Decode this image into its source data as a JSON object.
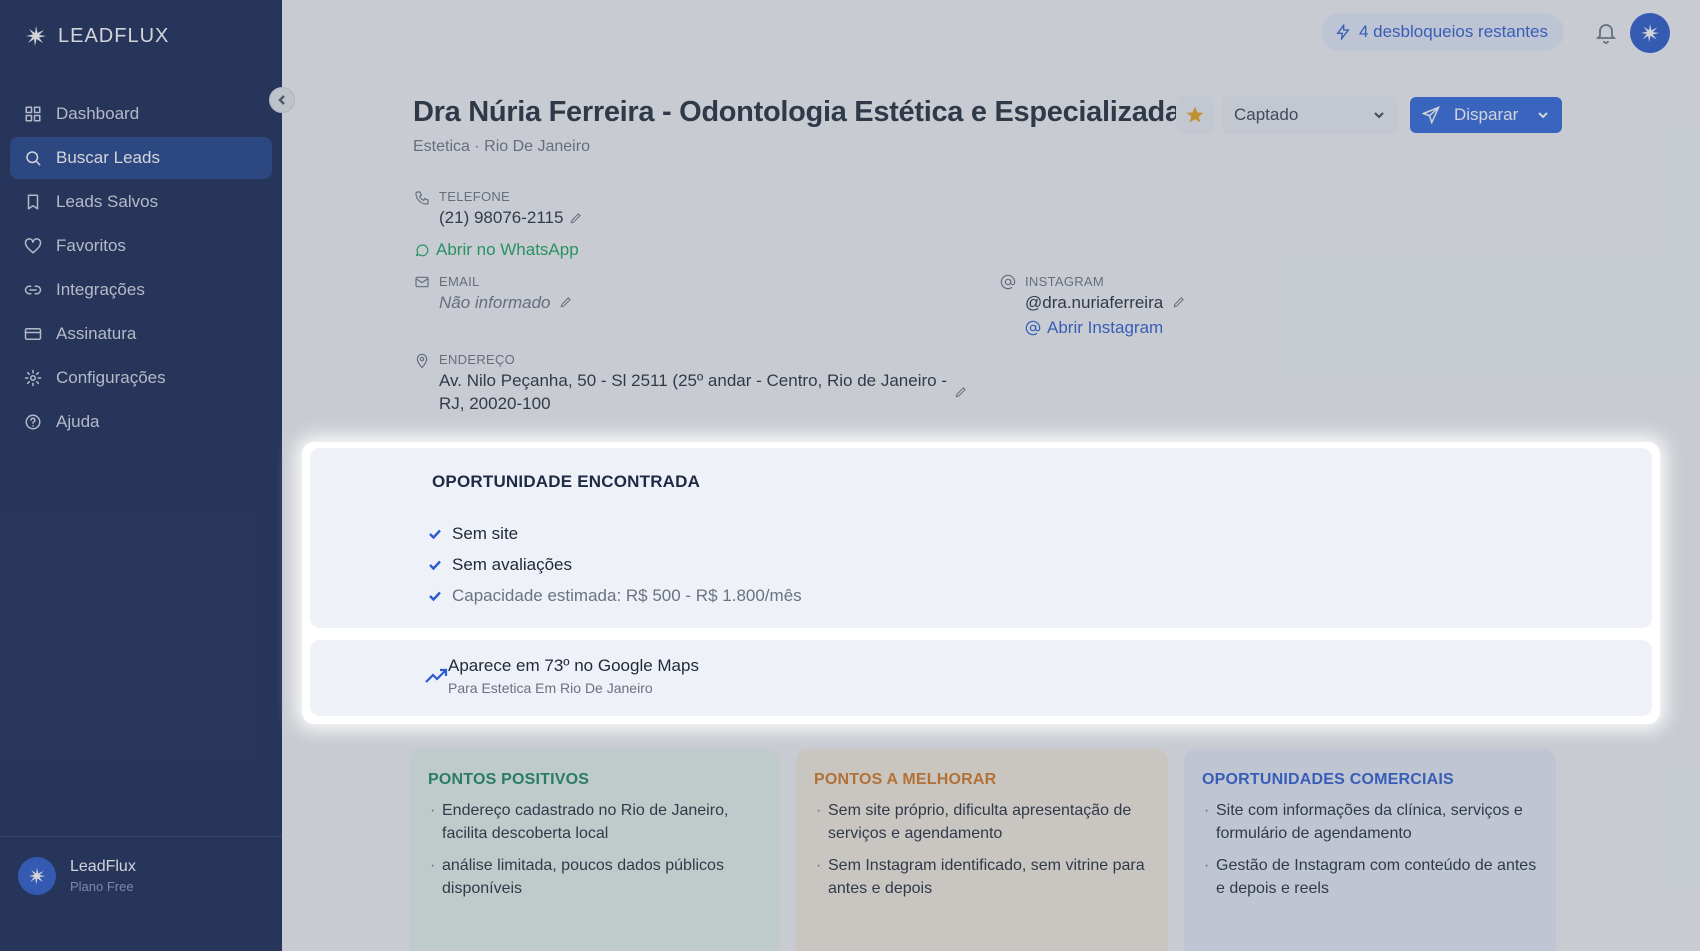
{
  "brand": {
    "name": "LEADFLUX"
  },
  "sidebar": {
    "items": [
      {
        "label": "Dashboard",
        "icon": "grid-icon"
      },
      {
        "label": "Buscar Leads",
        "icon": "search-icon",
        "active": true
      },
      {
        "label": "Leads Salvos",
        "icon": "bookmark-icon"
      },
      {
        "label": "Favoritos",
        "icon": "heart-icon"
      },
      {
        "label": "Integrações",
        "icon": "link-icon"
      },
      {
        "label": "Assinatura",
        "icon": "credit-card-icon"
      },
      {
        "label": "Configurações",
        "icon": "gear-icon"
      },
      {
        "label": "Ajuda",
        "icon": "help-icon"
      }
    ],
    "footer": {
      "name": "LeadFlux",
      "plan": "Plano Free"
    }
  },
  "topbar": {
    "unlocks": "4 desbloqueios restantes"
  },
  "lead": {
    "title": "Dra Núria Ferreira - Odontologia Estética e Especializada",
    "subtitle": "Estetica · Rio De Janeiro",
    "status": "Captado",
    "send_label": "Disparar",
    "phone_label": "TELEFONE",
    "phone": "(21) 98076-2115",
    "whatsapp_link": "Abrir no WhatsApp",
    "email_label": "EMAIL",
    "email": "Não informado",
    "instagram_label": "INSTAGRAM",
    "instagram": "@dra.nuriaferreira",
    "instagram_link": "Abrir Instagram",
    "address_label": "ENDEREÇO",
    "address_line1": "Av. Nilo Peçanha, 50 - Sl 2511 (25º andar - Centro, Rio de Janeiro -",
    "address_line2": "RJ, 20020-100"
  },
  "opportunity": {
    "title": "OPORTUNIDADE ENCONTRADA",
    "items": [
      "Sem site",
      "Sem avaliações",
      "Capacidade estimada: R$ 500 - R$ 1.800/mês"
    ],
    "rank_title": "Aparece em 73º no Google Maps",
    "rank_sub": "Para Estetica Em Rio De Janeiro"
  },
  "cards": {
    "positive": {
      "title": "PONTOS POSITIVOS",
      "items": [
        "Endereço cadastrado no Rio de Janeiro, facilita descoberta local",
        "análise limitada, poucos dados públicos disponíveis"
      ]
    },
    "improve": {
      "title": "PONTOS A MELHORAR",
      "items": [
        "Sem site próprio, dificulta apresentação de serviços e agendamento",
        "Sem Instagram identificado, sem vitrine para antes e depois"
      ]
    },
    "commercial": {
      "title": "OPORTUNIDADES COMERCIAIS",
      "items": [
        "Site com informações da clínica, serviços e formulário de agendamento",
        "Gestão de Instagram com conteúdo de antes e depois e reels"
      ]
    }
  },
  "colors": {
    "sidebar": "#16234f",
    "accent": "#2f66da",
    "positive": "#17875a",
    "improve": "#d5781c"
  }
}
